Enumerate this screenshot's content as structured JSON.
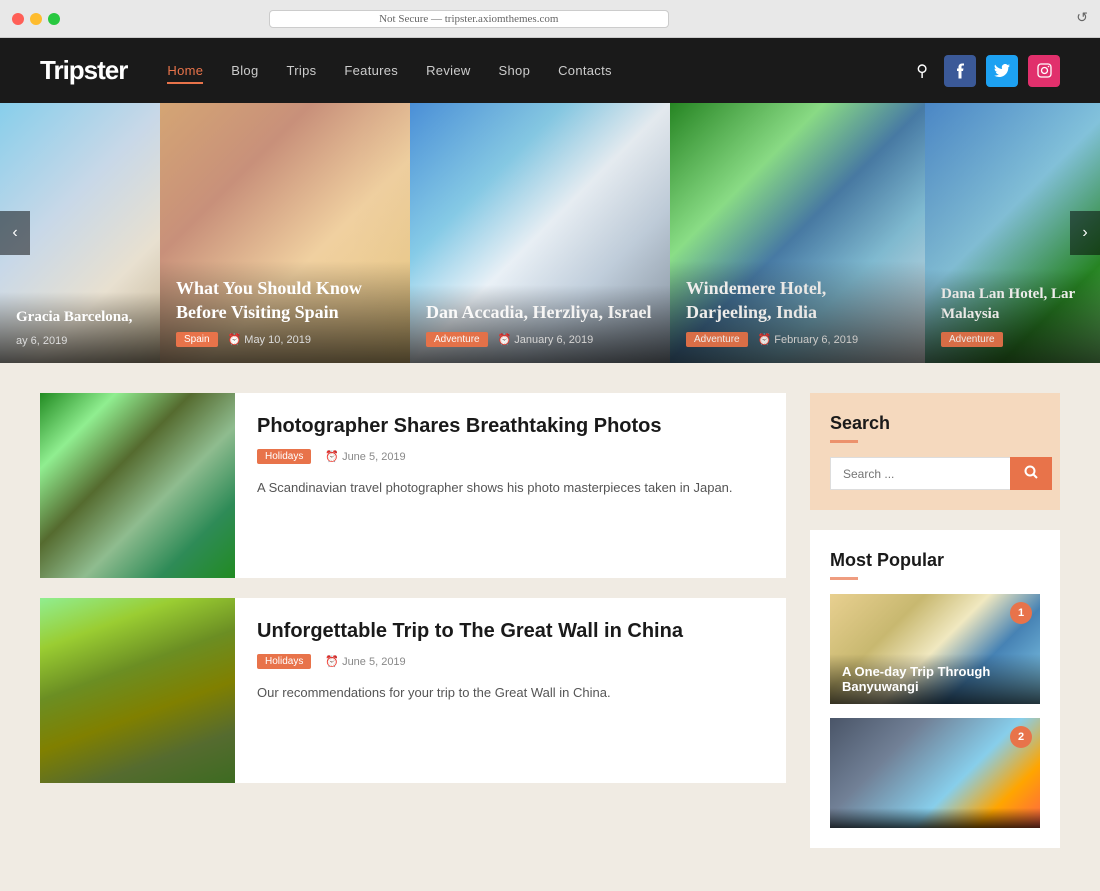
{
  "browser": {
    "url": "Not Secure — tripster.axiomthemes.com",
    "reload_icon": "↺"
  },
  "header": {
    "logo_part1": "Trip",
    "logo_part2": "ster",
    "nav": [
      {
        "label": "Home",
        "active": true
      },
      {
        "label": "Blog",
        "active": false
      },
      {
        "label": "Trips",
        "active": false
      },
      {
        "label": "Features",
        "active": false
      },
      {
        "label": "Review",
        "active": false
      },
      {
        "label": "Shop",
        "active": false
      },
      {
        "label": "Contacts",
        "active": false
      }
    ],
    "social": [
      {
        "name": "facebook",
        "icon": "f"
      },
      {
        "name": "twitter",
        "icon": "t"
      },
      {
        "name": "instagram",
        "icon": "i"
      }
    ]
  },
  "slider": {
    "prev_label": "‹",
    "next_label": "›",
    "slides": [
      {
        "title": "Gracia Barcelona,",
        "tag": "",
        "date": "ay 6, 2019",
        "partial": true
      },
      {
        "title": "What You Should Know Before Visiting Spain",
        "tag": "Spain",
        "date": "May 10, 2019"
      },
      {
        "title": "Dan Accadia, Herzliya, Israel",
        "tag": "Adventure",
        "date": "January 6, 2019"
      },
      {
        "title": "Windemere Hotel, Darjeeling, India",
        "tag": "Adventure",
        "date": "February 6, 2019"
      },
      {
        "title": "Dana Lan Hotel, Lar Malaysia",
        "tag": "Adventure",
        "date": "",
        "partial": true
      }
    ]
  },
  "articles": [
    {
      "title": "Photographer Shares Breathtaking Photos",
      "tag": "Holidays",
      "date": "June 5, 2019",
      "description": "A Scandinavian travel photographer shows his photo masterpieces taken in Japan."
    },
    {
      "title": "Unforgettable Trip to The Great Wall in China",
      "tag": "Holidays",
      "date": "June 5, 2019",
      "description": "Our recommendations for your trip to the Great Wall in China."
    }
  ],
  "sidebar": {
    "search_widget": {
      "title": "Search",
      "placeholder": "Search ..."
    },
    "popular_widget": {
      "title": "Most Popular",
      "items": [
        {
          "num": "1",
          "title": "A One-day Trip Through Banyuwangi"
        },
        {
          "num": "2",
          "title": ""
        }
      ]
    }
  }
}
